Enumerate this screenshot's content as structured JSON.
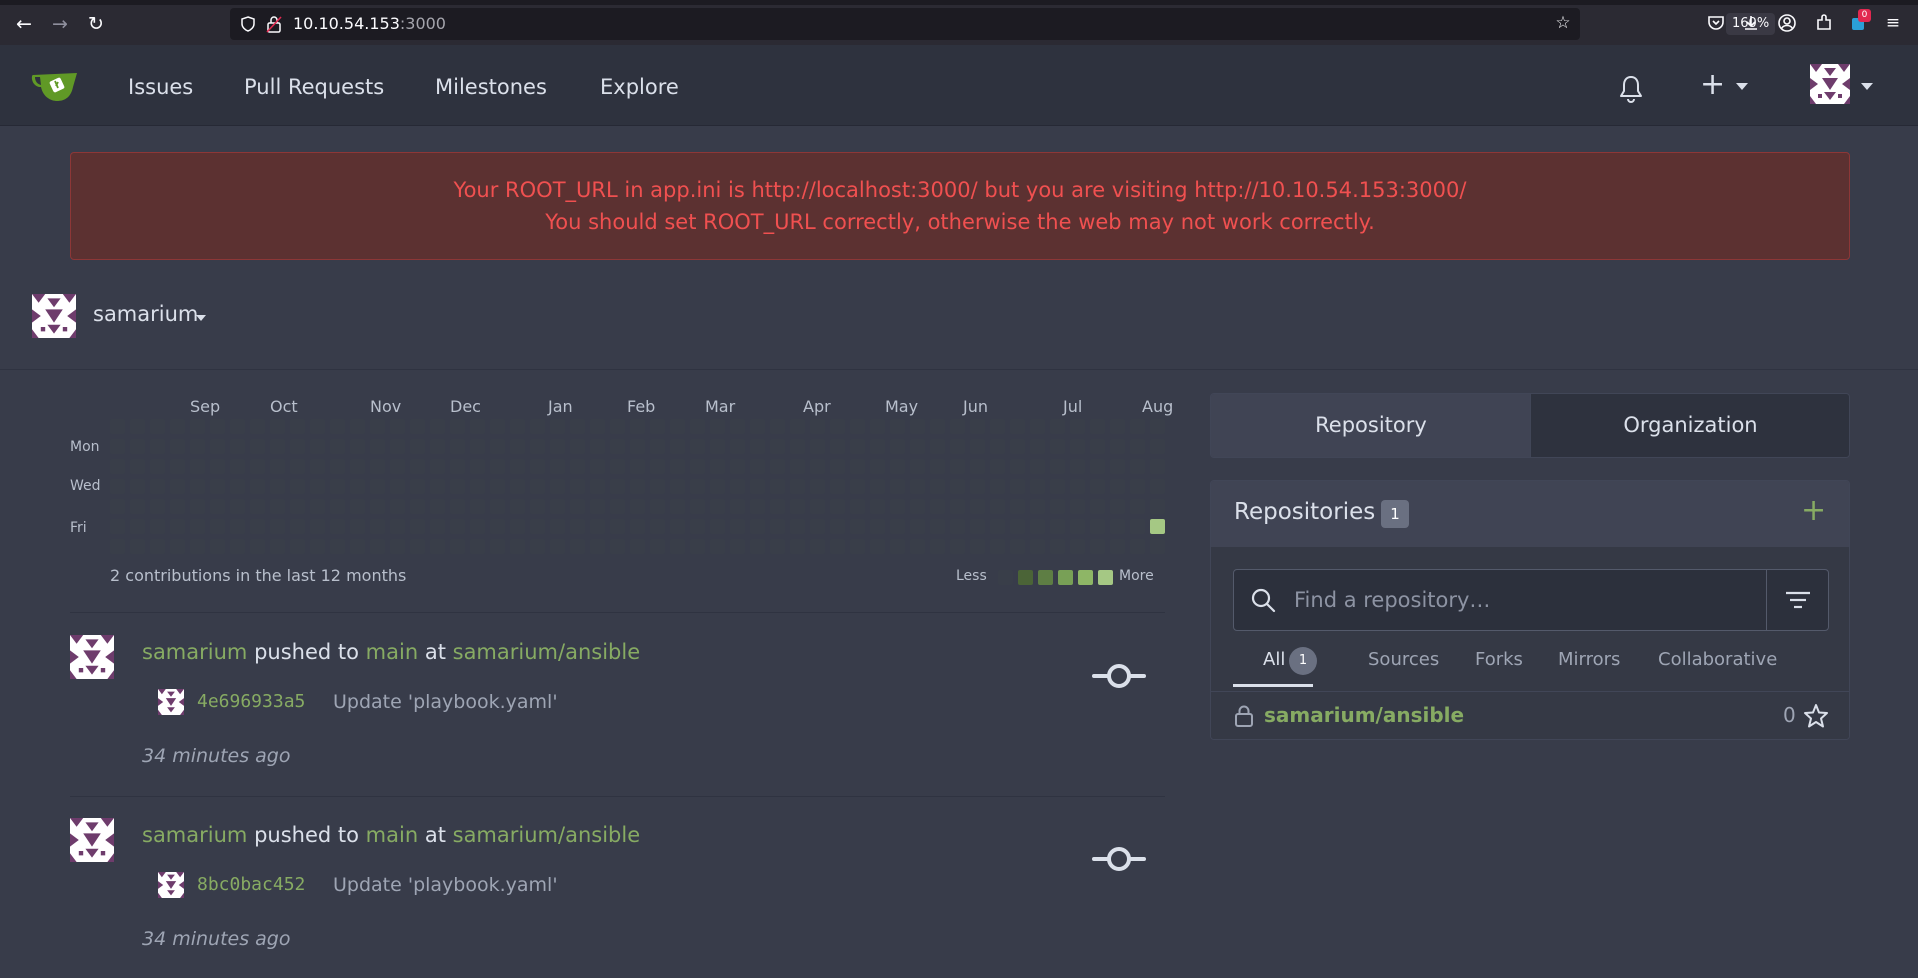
{
  "browser": {
    "url_host": "10.10.54.153",
    "url_port": ":3000",
    "zoom": "160%",
    "notification_count": "0"
  },
  "nav": {
    "items": [
      "Issues",
      "Pull Requests",
      "Milestones",
      "Explore"
    ]
  },
  "warning": {
    "line1": "Your ROOT_URL in app.ini is http://localhost:3000/ but you are visiting http://10.10.54.153:3000/",
    "line2": "You should set ROOT_URL correctly, otherwise the web may not work correctly."
  },
  "user": {
    "name": "samarium"
  },
  "heatmap": {
    "months": [
      "Sep",
      "Oct",
      "Nov",
      "Dec",
      "Jan",
      "Feb",
      "Mar",
      "Apr",
      "May",
      "Jun",
      "Jul",
      "Aug"
    ],
    "days": [
      "Mon",
      "Wed",
      "Fri"
    ],
    "summary": "2 contributions in the last 12 months",
    "legend_less": "Less",
    "legend_more": "More",
    "colors": [
      "#393e49",
      "#4b6437",
      "#5e7e44",
      "#78a056",
      "#8eb666",
      "#a5c884"
    ]
  },
  "feed": [
    {
      "actor": "samarium",
      "verb": "pushed to",
      "branch": "main",
      "prep": "at",
      "repo": "samarium/ansible",
      "sha": "4e696933a5",
      "message": "Update 'playbook.yaml'",
      "time": "34 minutes ago"
    },
    {
      "actor": "samarium",
      "verb": "pushed to",
      "branch": "main",
      "prep": "at",
      "repo": "samarium/ansible",
      "sha": "8bc0bac452",
      "message": "Update 'playbook.yaml'",
      "time": "34 minutes ago"
    }
  ],
  "panel": {
    "tab_repository": "Repository",
    "tab_organization": "Organization",
    "repos_title": "Repositories",
    "repos_count": "1",
    "search_placeholder": "Find a repository…",
    "filters": [
      "All",
      "Sources",
      "Forks",
      "Mirrors",
      "Collaborative"
    ],
    "all_count": "1",
    "repo_name": "samarium/ansible",
    "repo_stars": "0"
  },
  "accent": "#87ab63"
}
